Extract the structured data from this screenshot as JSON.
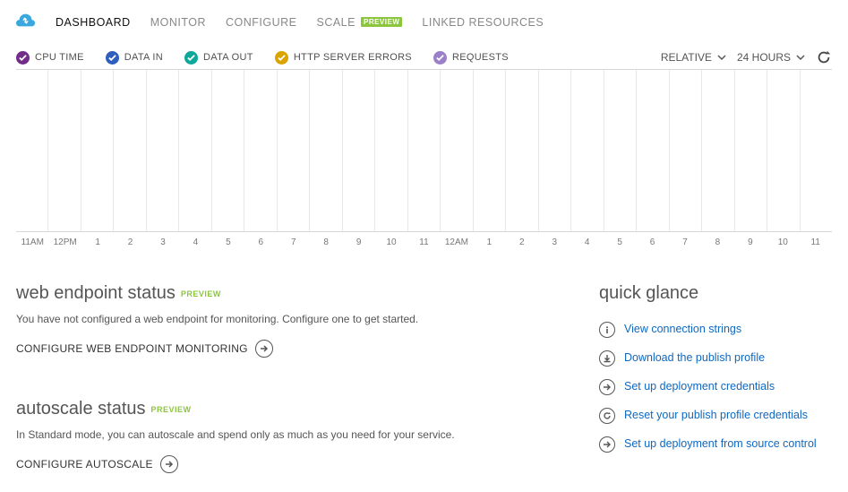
{
  "tabs": [
    {
      "label": "DASHBOARD",
      "active": true,
      "preview": false
    },
    {
      "label": "MONITOR",
      "active": false,
      "preview": false
    },
    {
      "label": "CONFIGURE",
      "active": false,
      "preview": false
    },
    {
      "label": "SCALE",
      "active": false,
      "preview": true
    },
    {
      "label": "LINKED RESOURCES",
      "active": false,
      "preview": false
    }
  ],
  "legend": [
    {
      "label": "CPU TIME",
      "color": "#722D88"
    },
    {
      "label": "DATA IN",
      "color": "#2F5EBE"
    },
    {
      "label": "DATA OUT",
      "color": "#0EA89B"
    },
    {
      "label": "HTTP SERVER ERRORS",
      "color": "#D9A400"
    },
    {
      "label": "REQUESTS",
      "color": "#9B7FC8"
    }
  ],
  "time": {
    "mode": "RELATIVE",
    "range": "24 HOURS"
  },
  "chart_data": {
    "type": "line",
    "title": "",
    "xlabel": "",
    "ylabel": "",
    "series": [
      {
        "name": "CPU TIME",
        "values": []
      },
      {
        "name": "DATA IN",
        "values": []
      },
      {
        "name": "DATA OUT",
        "values": []
      },
      {
        "name": "HTTP SERVER ERRORS",
        "values": []
      },
      {
        "name": "REQUESTS",
        "values": []
      }
    ],
    "categories": [
      "11AM",
      "12PM",
      "1",
      "2",
      "3",
      "4",
      "5",
      "6",
      "7",
      "8",
      "9",
      "10",
      "11",
      "12AM",
      "1",
      "2",
      "3",
      "4",
      "5",
      "6",
      "7",
      "8",
      "9",
      "10",
      "11"
    ]
  },
  "web_endpoint": {
    "title": "web endpoint status",
    "preview": "PREVIEW",
    "desc": "You have not configured a web endpoint for monitoring. Configure one to get started.",
    "action": "CONFIGURE WEB ENDPOINT MONITORING"
  },
  "autoscale": {
    "title": "autoscale status",
    "preview": "PREVIEW",
    "desc": "In Standard mode, you can autoscale and spend only as much as you need for your service.",
    "action": "CONFIGURE AUTOSCALE"
  },
  "quick_glance": {
    "title": "quick glance",
    "items": [
      {
        "icon": "info",
        "label": "View connection strings"
      },
      {
        "icon": "download",
        "label": "Download the publish profile"
      },
      {
        "icon": "arrow",
        "label": "Set up deployment credentials"
      },
      {
        "icon": "refresh",
        "label": "Reset your publish profile credentials"
      },
      {
        "icon": "arrow",
        "label": "Set up deployment from source control"
      }
    ]
  }
}
